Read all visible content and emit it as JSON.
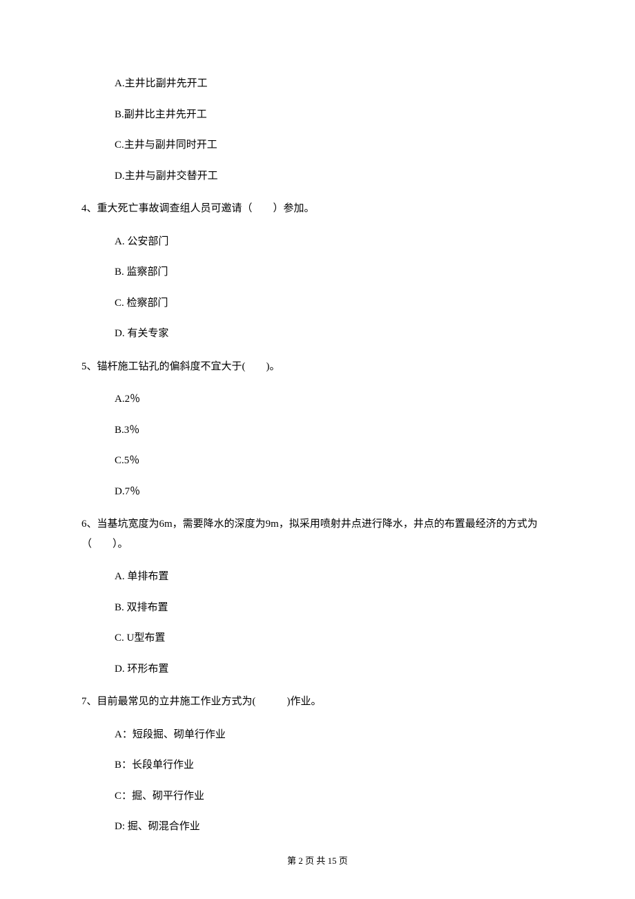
{
  "q3_options": {
    "A": "A.主井比副井先开工",
    "B": "B.副井比主井先开工",
    "C": "C.主井与副井同时开工",
    "D": "D.主井与副井交替开工"
  },
  "q4": {
    "stem": "4、重大死亡事故调查组人员可邀请（　　）参加。",
    "options": {
      "A": "A.  公安部门",
      "B": "B.  监察部门",
      "C": "C.  检察部门",
      "D": "D.  有关专家"
    }
  },
  "q5": {
    "stem": "5、锚杆施工钻孔的偏斜度不宜大于(　　)。",
    "options": {
      "A": "A.2％",
      "B": "B.3％",
      "C": "C.5％",
      "D": "D.7％"
    }
  },
  "q6": {
    "stem": "6、当基坑宽度为6m，需要降水的深度为9m，拟采用喷射井点进行降水，井点的布置最经济的方式为（　　）。",
    "options": {
      "A": "A.  单排布置",
      "B": "B.  双排布置",
      "C": "C.  U型布置",
      "D": "D.  环形布置"
    }
  },
  "q7": {
    "stem": "7、目前最常见的立井施工作业方式为(　　　)作业。",
    "options": {
      "A": "A：短段掘、砌单行作业",
      "B": "B：长段单行作业",
      "C": "C：掘、砌平行作业",
      "D": "D: 掘、砌混合作业"
    }
  },
  "footer": "第 2 页 共 15 页"
}
